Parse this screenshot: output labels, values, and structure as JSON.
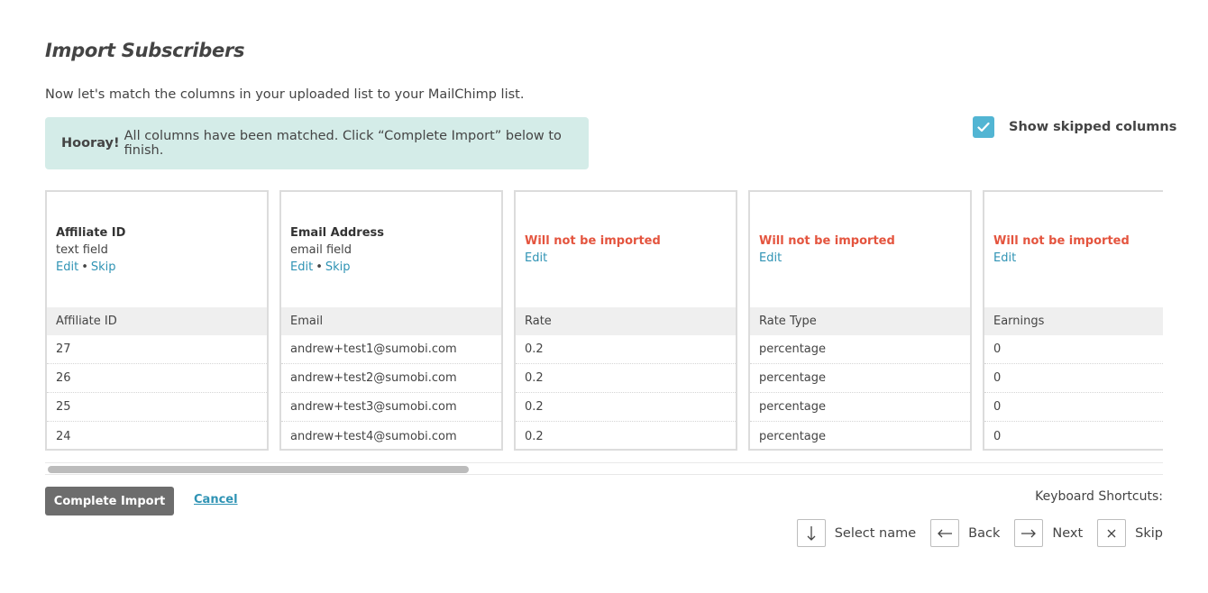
{
  "header": {
    "title": "Import Subscribers",
    "intro": "Now let's match the columns in your uploaded list to your MailChimp list."
  },
  "banner": {
    "strong": "Hooray!",
    "message": "All columns have been matched. Click “Complete Import” below to finish."
  },
  "options": {
    "show_skipped_label": "Show skipped columns",
    "show_skipped_checked": true
  },
  "columns": [
    {
      "status": "matched",
      "field_name": "Affiliate ID",
      "field_type": "text field",
      "edit_label": "Edit",
      "separator": "•",
      "skip_label": "Skip",
      "sample_header": "Affiliate ID",
      "rows": [
        "27",
        "26",
        "25",
        "24"
      ]
    },
    {
      "status": "matched",
      "field_name": "Email Address",
      "field_type": "email field",
      "edit_label": "Edit",
      "separator": "•",
      "skip_label": "Skip",
      "sample_header": "Email",
      "rows": [
        "andrew+test1@sumobi.com",
        "andrew+test2@sumobi.com",
        "andrew+test3@sumobi.com",
        "andrew+test4@sumobi.com"
      ]
    },
    {
      "status": "skipped",
      "warning": "Will not be imported",
      "edit_label": "Edit",
      "sample_header": "Rate",
      "rows": [
        "0.2",
        "0.2",
        "0.2",
        "0.2"
      ]
    },
    {
      "status": "skipped",
      "warning": "Will not be imported",
      "edit_label": "Edit",
      "sample_header": "Rate Type",
      "rows": [
        "percentage",
        "percentage",
        "percentage",
        "percentage"
      ]
    },
    {
      "status": "skipped",
      "warning": "Will not be imported",
      "edit_label": "Edit",
      "sample_header": "Earnings",
      "rows": [
        "0",
        "0",
        "0",
        "0"
      ]
    }
  ],
  "actions": {
    "complete_label": "Complete Import",
    "cancel_label": "Cancel"
  },
  "shortcuts": {
    "title": "Keyboard Shortcuts:",
    "select_name": "Select name",
    "back": "Back",
    "next": "Next",
    "skip": "Skip"
  },
  "colors": {
    "accent": "#52b5d3",
    "link": "#2f93b4",
    "warning": "#e4543e",
    "banner_bg": "#d4ece8",
    "primary_button": "#6d6d6d"
  }
}
